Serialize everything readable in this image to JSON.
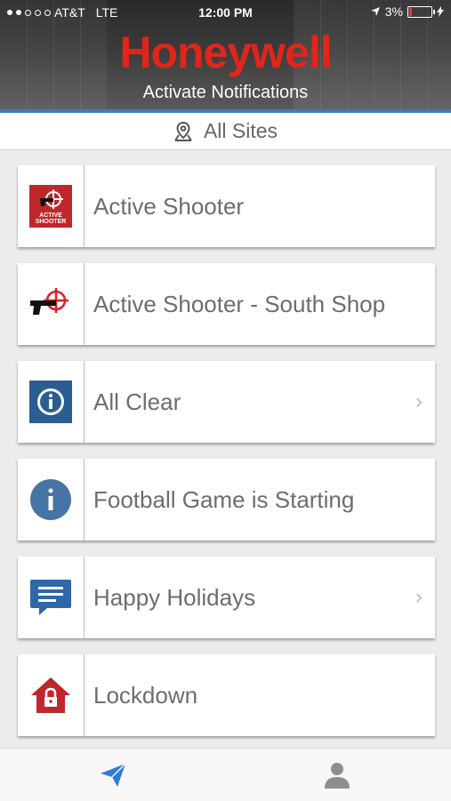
{
  "status_bar": {
    "carrier": "AT&T",
    "network": "LTE",
    "time": "12:00 PM",
    "battery": "3%"
  },
  "header": {
    "brand": "Honeywell",
    "title": "Activate Notifications",
    "brand_color": "#e1251b",
    "accent_color": "#3f7cc0"
  },
  "site_selector": {
    "label": "All Sites",
    "icon": "location-pin-icon"
  },
  "notifications": [
    {
      "label": "Active Shooter",
      "icon": "active-shooter-icon",
      "icon_text": "ACTIVE SHOOTER",
      "has_chevron": false
    },
    {
      "label": "Active Shooter - South Shop",
      "icon": "gun-crosshair-icon",
      "has_chevron": false
    },
    {
      "label": "All Clear",
      "icon": "info-square-icon",
      "has_chevron": true
    },
    {
      "label": "Football Game is Starting",
      "icon": "info-circle-icon",
      "has_chevron": false
    },
    {
      "label": "Happy Holidays",
      "icon": "message-bubble-icon",
      "has_chevron": true
    },
    {
      "label": "Lockdown",
      "icon": "house-lock-icon",
      "has_chevron": false
    }
  ],
  "chevron": "›",
  "tabbar": {
    "tabs": [
      {
        "name": "send-tab",
        "icon": "paper-plane-icon",
        "active": true
      },
      {
        "name": "profile-tab",
        "icon": "person-icon",
        "active": false
      }
    ],
    "active_color": "#2f7bd6",
    "inactive_color": "#8e8e8e"
  }
}
